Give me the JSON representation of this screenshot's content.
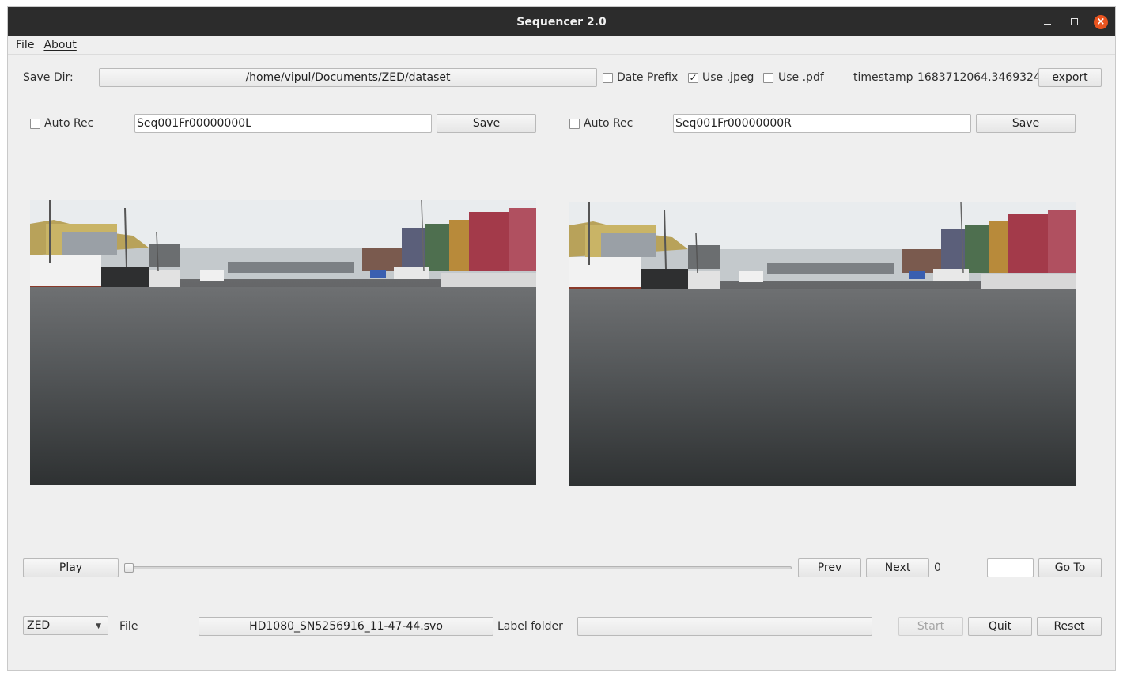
{
  "window": {
    "title": "Sequencer 2.0"
  },
  "menu": {
    "file": "File",
    "about": "About"
  },
  "top": {
    "save_dir_label": "Save Dir:",
    "save_dir_value": "/home/vipul/Documents/ZED/dataset",
    "date_prefix_label": "Date Prefix",
    "date_prefix_checked": false,
    "use_jpeg_label": "Use .jpeg",
    "use_jpeg_checked": true,
    "use_pdf_label": "Use .pdf",
    "use_pdf_checked": false,
    "timestamp_label": "timestamp",
    "timestamp_value": "1683712064.3469324",
    "export_label": "export"
  },
  "left": {
    "auto_rec_label": "Auto Rec",
    "auto_rec_checked": false,
    "name_value": "Seq001Fr00000000L",
    "save_label": "Save"
  },
  "right": {
    "auto_rec_label": "Auto Rec",
    "auto_rec_checked": false,
    "name_value": "Seq001Fr00000000R",
    "save_label": "Save"
  },
  "playback": {
    "play_label": "Play",
    "slider_position": 0,
    "prev_label": "Prev",
    "next_label": "Next",
    "frame_value": "0",
    "goto_value": "",
    "goto_label": "Go To"
  },
  "bottom": {
    "source_selected": "ZED",
    "file_label": "File",
    "file_value": "HD1080_SN5256916_11-47-44.svo",
    "label_folder_label": "Label folder",
    "label_folder_value": "",
    "start_label": "Start",
    "start_disabled": true,
    "quit_label": "Quit",
    "reset_label": "Reset"
  },
  "icons": {
    "minimize": "minimize-icon",
    "maximize": "maximize-icon",
    "close": "close-icon",
    "dropdown": "chevron-down-icon",
    "check": "✓",
    "close_glyph": "×"
  },
  "colors": {
    "titlebar": "#2c2c2c",
    "window_bg": "#efefef",
    "close_button": "#e9541f"
  }
}
